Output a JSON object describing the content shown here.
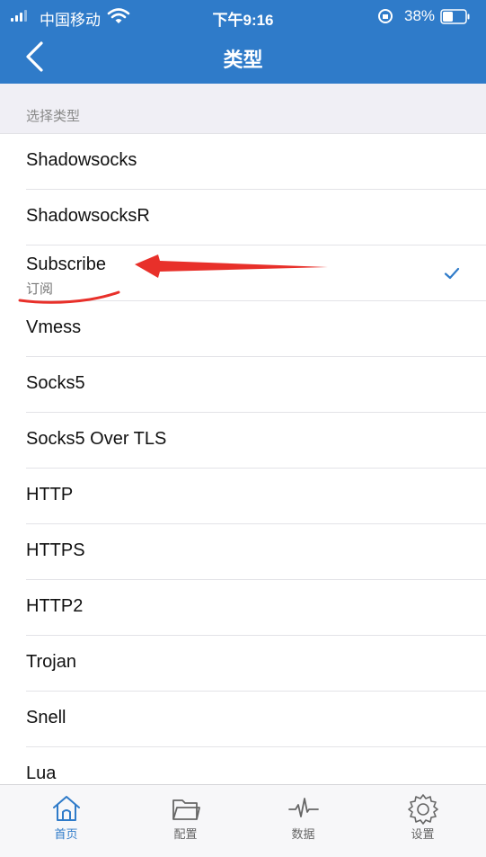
{
  "status_bar": {
    "carrier": "中国移动",
    "time": "下午9:16",
    "battery": "38%"
  },
  "nav": {
    "title": "类型"
  },
  "section_header": "选择类型",
  "types": [
    {
      "label": "Shadowsocks"
    },
    {
      "label": "ShadowsocksR"
    },
    {
      "label": "Subscribe",
      "sub": "订阅",
      "selected": true
    },
    {
      "label": "Vmess"
    },
    {
      "label": "Socks5"
    },
    {
      "label": "Socks5 Over TLS"
    },
    {
      "label": "HTTP"
    },
    {
      "label": "HTTPS"
    },
    {
      "label": "HTTP2"
    },
    {
      "label": "Trojan"
    },
    {
      "label": "Snell"
    },
    {
      "label": "Lua"
    }
  ],
  "tabs": [
    {
      "label": "首页",
      "icon": "home-icon",
      "active": true
    },
    {
      "label": "配置",
      "icon": "folder-icon",
      "active": false
    },
    {
      "label": "数据",
      "icon": "pulse-icon",
      "active": false
    },
    {
      "label": "设置",
      "icon": "gear-icon",
      "active": false
    }
  ],
  "colors": {
    "accent": "#2f7bc9",
    "annotation": "#e8302a"
  }
}
